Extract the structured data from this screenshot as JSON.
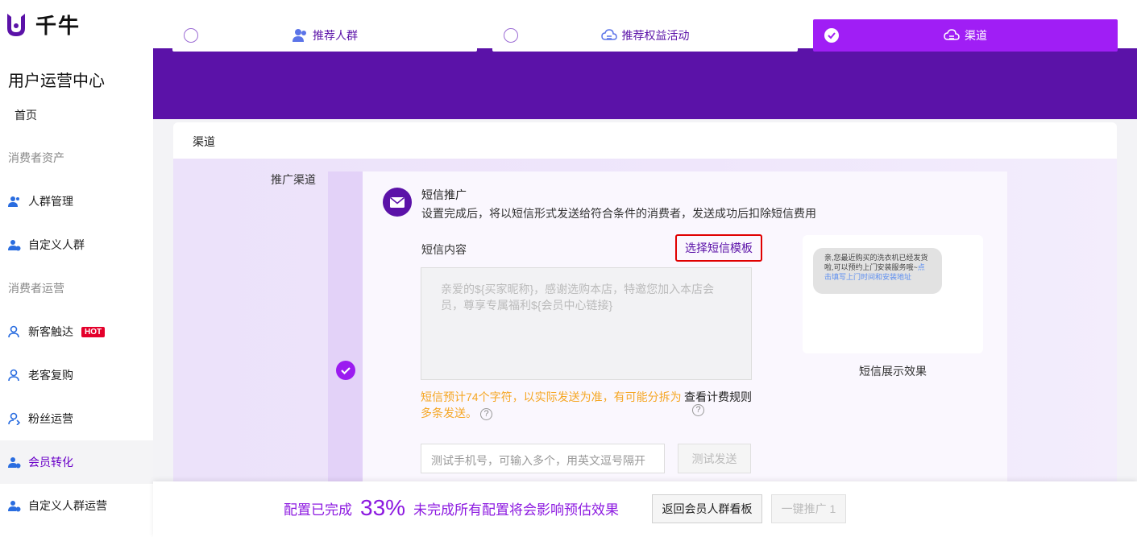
{
  "app": {
    "logo_text": "千牛"
  },
  "sidebar": {
    "title": "用户运营中心",
    "home": "首页",
    "section1": "消费者资产",
    "items1": [
      {
        "label": "人群管理",
        "icon": "users-icon"
      },
      {
        "label": "自定义人群",
        "icon": "custom-users-icon"
      }
    ],
    "section2": "消费者运营",
    "items2": [
      {
        "label": "新客触达",
        "icon": "new-customer-icon",
        "badge": "HOT"
      },
      {
        "label": "老客复购",
        "icon": "old-customer-icon"
      },
      {
        "label": "粉丝运营",
        "icon": "fans-icon"
      },
      {
        "label": "会员转化",
        "icon": "member-icon",
        "active": true
      },
      {
        "label": "自定义人群运营",
        "icon": "custom-group-icon"
      }
    ]
  },
  "steps": [
    {
      "label": "推荐人群",
      "icon": "people-icon",
      "done": false
    },
    {
      "label": "推荐权益活动",
      "icon": "cloud-icon",
      "done": false
    },
    {
      "label": "渠道",
      "icon": "cloud-icon",
      "done": true
    }
  ],
  "card": {
    "title": "渠道",
    "field_label": "推广渠道",
    "sms_title": "短信推广",
    "sms_desc": "设置完成后，将以短信形式发送给符合条件的消费者，发送成功后扣除短信费用",
    "content_label": "短信内容",
    "template_button": "选择短信模板",
    "textarea_placeholder": "亲爱的${买家昵称}，感谢选购本店，特邀您加入本店会员，尊享专属福利${会员中心链接}",
    "warning": "短信预计74个字符，以实际发送为准，有可能分拆为多条发送。",
    "fee_rule": "查看计费规则",
    "phone_placeholder": "测试手机号，可输入多个，用英文逗号隔开",
    "test_button": "测试发送",
    "preview_text": "亲,您最近购买的洗衣机已经发货啦,可以预约上门安装服务哦~",
    "preview_link": "点击填写上门时间和安装地址",
    "preview_caption": "短信展示效果"
  },
  "footer": {
    "prefix": "配置已完成",
    "percent": "33%",
    "suffix": "未完成所有配置将会影响预估效果",
    "back_button": "返回会员人群看板",
    "promote_button": "一键推广 1"
  },
  "colors": {
    "brand": "#5b12a8",
    "accent": "#a01ef5",
    "warning": "#f5a623",
    "hot": "#e4002b"
  }
}
